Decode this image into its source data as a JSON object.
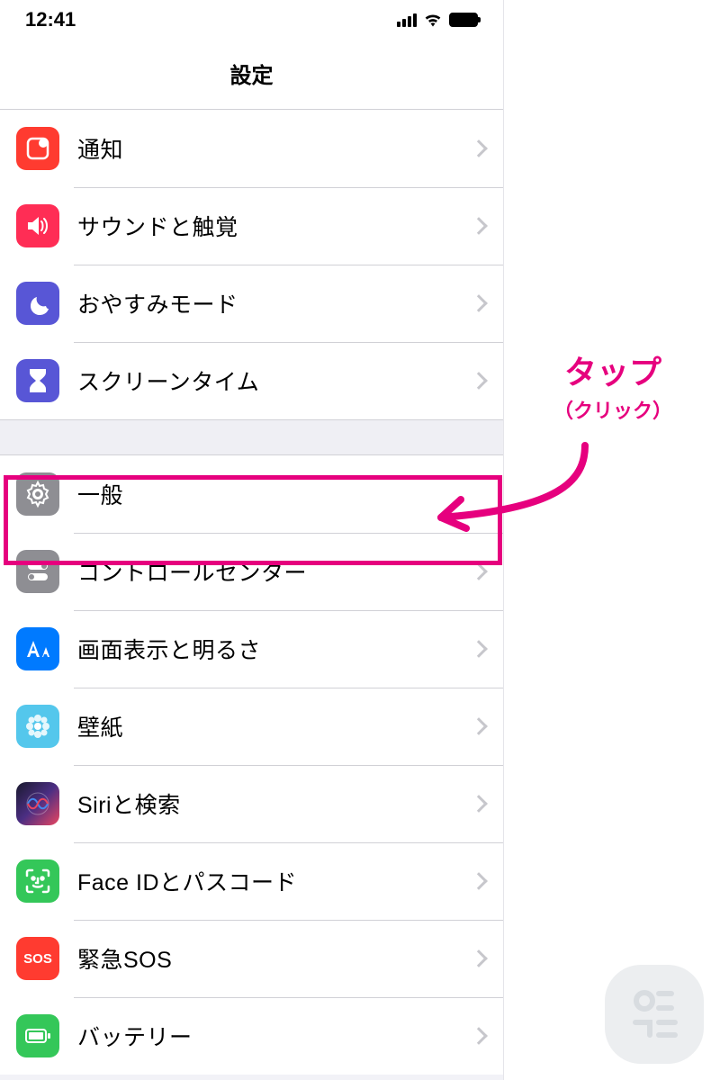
{
  "status": {
    "time": "12:41"
  },
  "nav": {
    "title": "設定"
  },
  "sections": [
    [
      {
        "id": "notifications",
        "label": "通知",
        "icon": "ic-notif",
        "iconName": "notification-icon"
      },
      {
        "id": "sounds",
        "label": "サウンドと触覚",
        "icon": "ic-sound",
        "iconName": "speaker-icon"
      },
      {
        "id": "dnd",
        "label": "おやすみモード",
        "icon": "ic-dnd",
        "iconName": "moon-icon"
      },
      {
        "id": "screentime",
        "label": "スクリーンタイム",
        "icon": "ic-screentime",
        "iconName": "hourglass-icon"
      }
    ],
    [
      {
        "id": "general",
        "label": "一般",
        "icon": "ic-general",
        "iconName": "gear-icon",
        "highlighted": true,
        "hideChevron": true
      },
      {
        "id": "control",
        "label": "コントロールセンター",
        "icon": "ic-control",
        "iconName": "switches-icon"
      },
      {
        "id": "display",
        "label": "画面表示と明るさ",
        "icon": "ic-display",
        "iconName": "text-size-icon"
      },
      {
        "id": "wallpaper",
        "label": "壁紙",
        "icon": "ic-wallpaper",
        "iconName": "flower-icon"
      },
      {
        "id": "siri",
        "label": "Siriと検索",
        "icon": "ic-siri",
        "iconName": "siri-icon"
      },
      {
        "id": "faceid",
        "label": "Face IDとパスコード",
        "icon": "ic-faceid",
        "iconName": "face-id-icon"
      },
      {
        "id": "sos",
        "label": "緊急SOS",
        "icon": "ic-sos",
        "iconName": "sos-icon",
        "iconText": "SOS"
      },
      {
        "id": "battery",
        "label": "バッテリー",
        "icon": "ic-battery",
        "iconName": "battery-icon"
      }
    ]
  ],
  "annotation": {
    "main": "タップ",
    "sub": "（クリック）"
  },
  "colors": {
    "accent": "#e6007e"
  }
}
